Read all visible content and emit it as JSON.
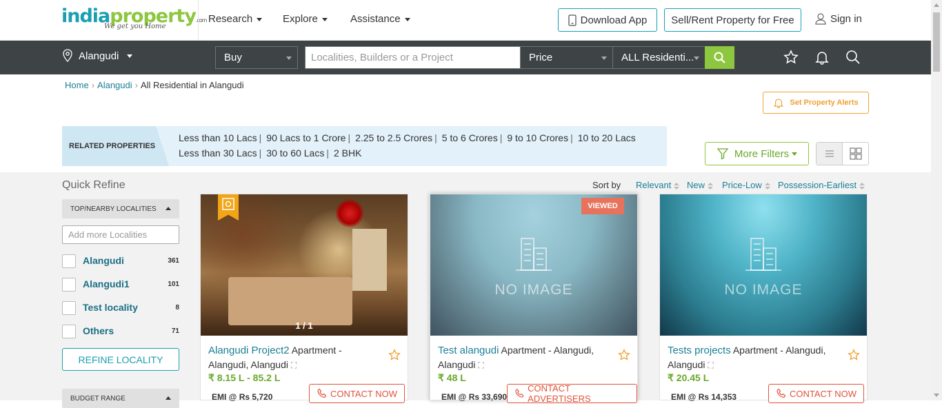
{
  "header": {
    "logo_main": "india",
    "logo_accent": "property",
    "logo_suffix": ".com",
    "logo_tagline": "We get you Home",
    "menu": [
      "Research",
      "Explore",
      "Assistance"
    ],
    "download_app": "Download App",
    "sell_rent": "Sell/Rent Property for Free",
    "sign_in": "Sign in"
  },
  "searchbar": {
    "city": "Alangudi",
    "mode": "Buy",
    "search_placeholder": "Localities, Builders or a Project",
    "price": "Price",
    "property_type": "ALL Residenti..."
  },
  "breadcrumb": [
    "Home",
    "Alangudi",
    "All Residential in Alangudi"
  ],
  "alerts_button": "Set Property Alerts",
  "related": {
    "label": "RELATED PROPERTIES",
    "links": [
      "Less than 10 Lacs",
      "90 Lacs to 1 Crore",
      "2.25 to 2.5 Crores",
      "5 to 6 Crores",
      "9 to 10 Crores",
      "10 to 20 Lacs",
      "Less than 30 Lacs",
      "30 to 60 Lacs",
      "2 BHK"
    ]
  },
  "more_filters": "More Filters",
  "quick_refine": {
    "title": "Quick Refine",
    "localities_header": "TOP/NEARBY LOCALITIES",
    "add_placeholder": "Add more Localities",
    "localities": [
      {
        "name": "Alangudi",
        "count": "361"
      },
      {
        "name": "Alangudi1",
        "count": "101"
      },
      {
        "name": "Test locality",
        "count": "8"
      },
      {
        "name": "Others",
        "count": "71"
      }
    ],
    "refine_button": "REFINE LOCALITY",
    "budget_header": "BUDGET RANGE"
  },
  "sort": {
    "label": "Sort by",
    "options": [
      "Relevant",
      "New",
      "Price-Low",
      "Possession-Earliest"
    ]
  },
  "cards": [
    {
      "project": "Alangudi Project2",
      "desc": " Apartment - Alangudi, Alangudi",
      "price": "₹ 8.15 L - 85.2 L",
      "emi": "EMI @ Rs 5,720",
      "contact": "CONTACT NOW",
      "counter": "1 / 1"
    },
    {
      "project": "Test alangudi",
      "desc": " Apartment - Alangudi, Alangudi",
      "price": "₹ 48 L",
      "emi": "EMI @ Rs 33,690",
      "contact": "CONTACT ADVERTISERS",
      "badge": "VIEWED",
      "no_image": "NO IMAGE"
    },
    {
      "project": "Tests projects",
      "desc": " Apartment - Alangudi, Alangudi",
      "price": "₹ 20.45 L",
      "emi": "EMI @ Rs 14,353",
      "contact": "CONTACT NOW",
      "no_image": "NO IMAGE"
    }
  ],
  "colors": {
    "brand_teal": "#1a9fb0",
    "brand_green": "#8dc63f",
    "accent_orange": "#f0a030",
    "contact_red": "#e0533a"
  }
}
